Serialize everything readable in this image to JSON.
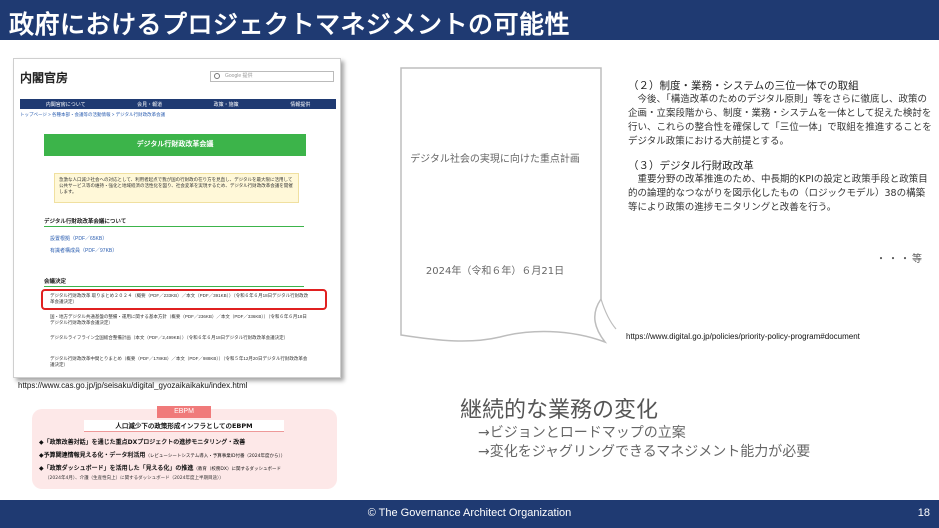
{
  "header": {
    "title": "政府におけるプロジェクトマネジメントの可能性"
  },
  "screenshot": {
    "logo": "内閣官房",
    "search_placeholder": "Google 提供",
    "nav": [
      "内閣官房について",
      "会見・報道",
      "政策・施策",
      "情報提供"
    ],
    "breadcrumb": "トップページ > 各種本部・会議等の活動情報 > デジタル行財政改革会議",
    "banner": "デジタル行財政改革会議",
    "intro": "急激な人口減少社会への対応として、利用者起点で我が国の行財政の在り方を見直し、デジタルを最大限に活用して公共サービス等の維持・強化と地域経済の活性化を図り、社会変革を実現するため、デジタル行財政改革会議を開催します。",
    "section1": "デジタル行財政改革会議について",
    "link1": "設置根拠（PDF／65KB）",
    "link2": "有識者構成員（PDF／97KB）",
    "section2": "会議決定",
    "item1": "デジタル行財政改革 取りまとめ２０２４（概要（PDF／233KB）／本文（PDF／391KB））（令和６年６月18日デジタル行財政改革会議決定）",
    "item2": "国・地方デジタル共通基盤の整備・運用に関する基本方針（概要（PDF／236KB）／本文（PDF／336KB））（令和６年６月18日デジタル行財政改革会議決定）",
    "item3": "デジタルライフライン全国総合整備計画（本文（PDF／2,499KB））（令和６年６月18日デジタル行財政改革会議決定）",
    "item4": "デジタル行財政改革中間とりまとめ（概要（PDF／178KB）／本文（PDF／988KB））（令和５年12月20日デジタル行財政改革会議決定）",
    "url": "https://www.cas.go.jp/jp/seisaku/digital_gyozaikaikaku/index.html"
  },
  "ebpm": {
    "tag": "EBPM",
    "title": "人口減少下の政策形成インフラとしてのEBPM",
    "line1": "◆「政策改善対話」を通じた重点DXプロジェクトの進捗モニタリング・改善",
    "line2": "◆予算関連情報見える化・データ利活用",
    "line2_sub": "（レビューシートシステム導入・予算事業ID付番（2024年度から））",
    "line3": "◆「政策ダッシュボード」を活用した「見える化」の推進",
    "line3_sub": "（教育（校務DX）に関するダッシュボード",
    "line4_sub": "（2024年4月）、介護（生産性向上）に関するダッシュボード（2024年度上半期目途））"
  },
  "document": {
    "title": "デジタル社会の実現に向けた重点計画",
    "date": "2024年（令和６年）６月21日"
  },
  "right": {
    "h1": "（２）制度・業務・システムの三位一体での取組",
    "p1": "　今後、「構造改革のためのデジタル原則」等をさらに徹底し、政策の企画・立案段階から、制度・業務・システムを一体として捉えた検討を行い、これらの整合性を確保して「三位一体」で取組を推進することをデジタル政策における大前提とする。",
    "h2": "（３）デジタル行財政改革",
    "p2": "　重要分野の改革推進のため、中長期的KPIの設定と政策手段と政策目的の論理的なつながりを図示化したもの（ロジックモデル）38の構築等により政策の進捗モニタリングと改善を行う。",
    "ellipsis": "・・・等",
    "url": "https://www.digital.go.jp/policies/priority-policy-program#document"
  },
  "statement": {
    "title": "継続的な業務の変化",
    "b1": "→ビジョンとロードマップの立案",
    "b2": "→変化をジャグリングできるマネジメント能力が必要"
  },
  "footer": {
    "org": "© The Governance Architect Organization",
    "page": "18"
  },
  "colors": {
    "header": "#1f3a72",
    "banner_green": "#3cb44a",
    "highlight_red": "#e02020",
    "ebpm_bg": "#fde8e8"
  }
}
